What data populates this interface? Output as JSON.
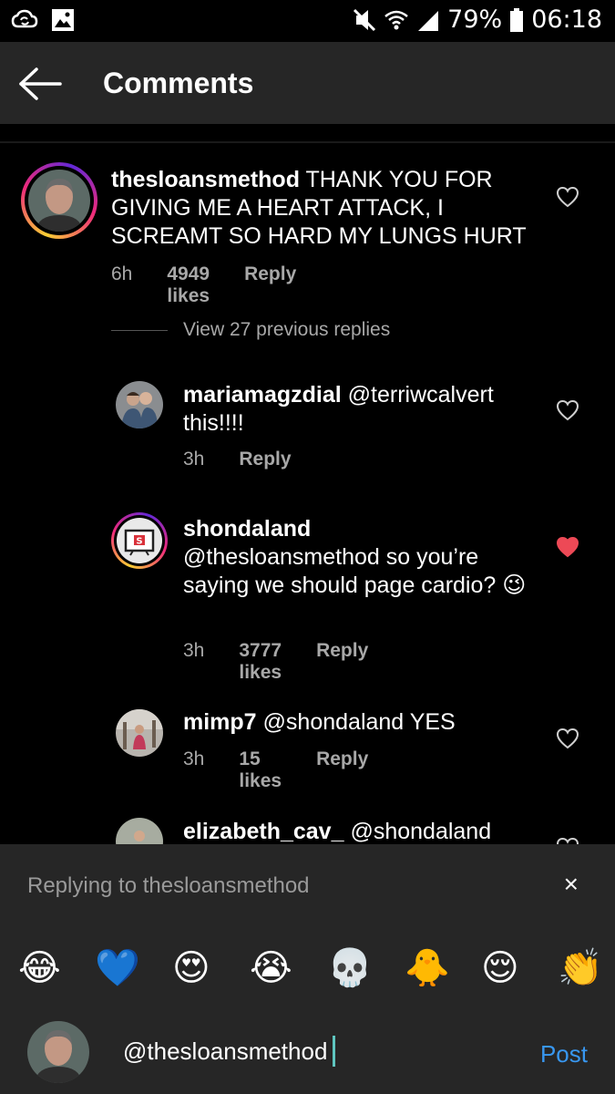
{
  "status_bar": {
    "battery": "79%",
    "time": "06:18",
    "icons": [
      "cloud-sync-icon",
      "image-icon",
      "mute-icon",
      "wifi-icon",
      "signal-icon",
      "battery-icon"
    ]
  },
  "header": {
    "title": "Comments",
    "back_icon": "arrow-left-icon"
  },
  "main_comment": {
    "username": "thesloansmethod",
    "text": "THANK YOU FOR GIVING ME A HEART ATTACK, I SCREAMT SO HARD MY LUNGS HURT",
    "time": "6h",
    "likes": "4949 likes",
    "reply": "Reply",
    "liked": false
  },
  "view_replies": "View 27 previous replies",
  "replies": [
    {
      "username": "mariamagzdial",
      "text": "@terriwcalvert this!!!!",
      "time": "3h",
      "likes": "",
      "reply": "Reply",
      "liked": false
    },
    {
      "username": "shondaland",
      "text": "@thesloansmethod so you’re saying we should page cardio? 😉",
      "time": "3h",
      "likes": "3777 likes",
      "reply": "Reply",
      "liked": true
    },
    {
      "username": "mimp7",
      "text": "@shondaland YES",
      "time": "3h",
      "likes": "15 likes",
      "reply": "Reply",
      "liked": false
    },
    {
      "username": "elizabeth_cav_",
      "text": "@shondaland",
      "time": "",
      "likes": "",
      "reply": "",
      "liked": false
    }
  ],
  "reply_bar": {
    "text": "Replying to thesloansmethod",
    "close": "×"
  },
  "emojis": [
    "😂",
    "💙",
    "😍",
    "😭",
    "💀",
    "🐥",
    "😌",
    "👏"
  ],
  "input": {
    "value": "@thesloansmethod",
    "post": "Post"
  },
  "colors": {
    "liked_heart": "#ed4956",
    "post_button": "#3897f0",
    "bar_bg": "#262626"
  }
}
